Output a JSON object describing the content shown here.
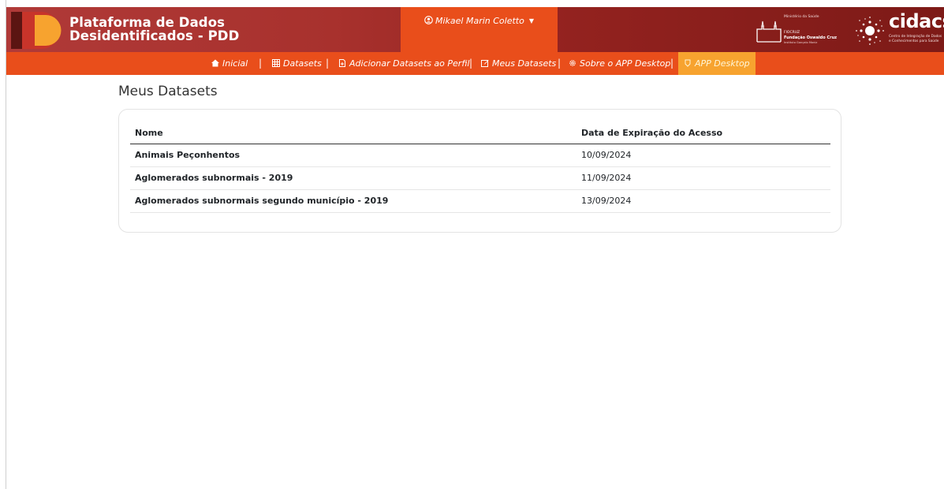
{
  "header": {
    "title_line1": "Plataforma de Dados",
    "title_line2": "Desidentificados - PDD",
    "user_name": "Mikael Marin Coletto",
    "ms_logo": {
      "ministry": "Ministério da Saúde",
      "fio_small": "FIOCRUZ",
      "fio_name": "Fundação Oswaldo Cruz",
      "fio_sub": "Instituto Gonçalo Moniz"
    },
    "cidacs_logo": {
      "word": "cidacs",
      "sub1": "Centro de Integração de Dados",
      "sub2": "e Conhecimentos para Saúde"
    }
  },
  "nav": {
    "items": [
      {
        "label": "Inicial",
        "icon": "home-icon"
      },
      {
        "label": "Datasets",
        "icon": "table-icon"
      },
      {
        "label": "Adicionar Datasets ao Perfil",
        "icon": "file-plus-icon"
      },
      {
        "label": "Meus Datasets",
        "icon": "edit-icon"
      },
      {
        "label": "Sobre o APP Desktop",
        "icon": "gear-icon"
      },
      {
        "label": "APP Desktop",
        "icon": "download-icon",
        "active": true
      }
    ],
    "separator": "|"
  },
  "main": {
    "page_title": "Meus Datasets",
    "table": {
      "columns": [
        "Nome",
        "Data de Expiração do Acesso"
      ],
      "rows": [
        {
          "nome": "Animais Peçonhentos",
          "data": "10/09/2024"
        },
        {
          "nome": "Aglomerados subnormais - 2019",
          "data": "11/09/2024"
        },
        {
          "nome": "Aglomerados subnormais segundo município - 2019",
          "data": "13/09/2024"
        }
      ]
    }
  },
  "colors": {
    "header_red": "#a8312d",
    "accent_orange": "#e94e1b",
    "active_tab": "#f7a32f"
  }
}
